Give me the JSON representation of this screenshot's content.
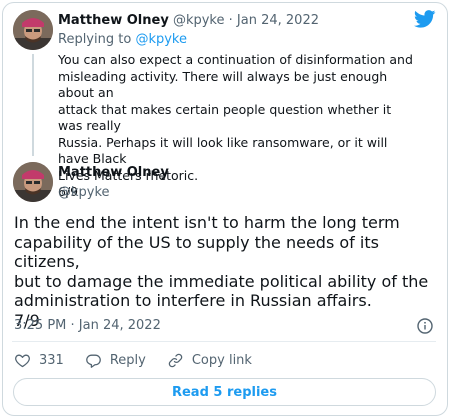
{
  "brand": {
    "accent": "#1d9bf0",
    "icon": "twitter-bird-icon"
  },
  "reply_tweet": {
    "author_name": "Matthew Olney",
    "handle": "@kpyke",
    "separator": "·",
    "date": "Jan 24, 2022",
    "replying_prefix": "Replying to",
    "replying_to": "@kpyke",
    "text": "You can also expect a continuation of disinformation and\nmisleading activity. There will always be just enough about an\nattack that makes certain people question whether it was really\nRussia. Perhaps it will look like ransomware, or it will have Black\nLives Matters rhetoric.\n6/9"
  },
  "main_tweet": {
    "author_name": "Matthew Olney",
    "handle": "@kpyke",
    "text": "In the end the intent isn't to harm the long term\ncapability of the US to supply the needs of its citizens,\nbut to damage the immediate political ability of the\nadministration to interfere in Russian affairs.\n7/9",
    "timestamp": "3:25 PM · Jan 24, 2022"
  },
  "actions": {
    "likes": "331",
    "reply_label": "Reply",
    "copy_link_label": "Copy link"
  },
  "read_replies_label": "Read 5 replies"
}
